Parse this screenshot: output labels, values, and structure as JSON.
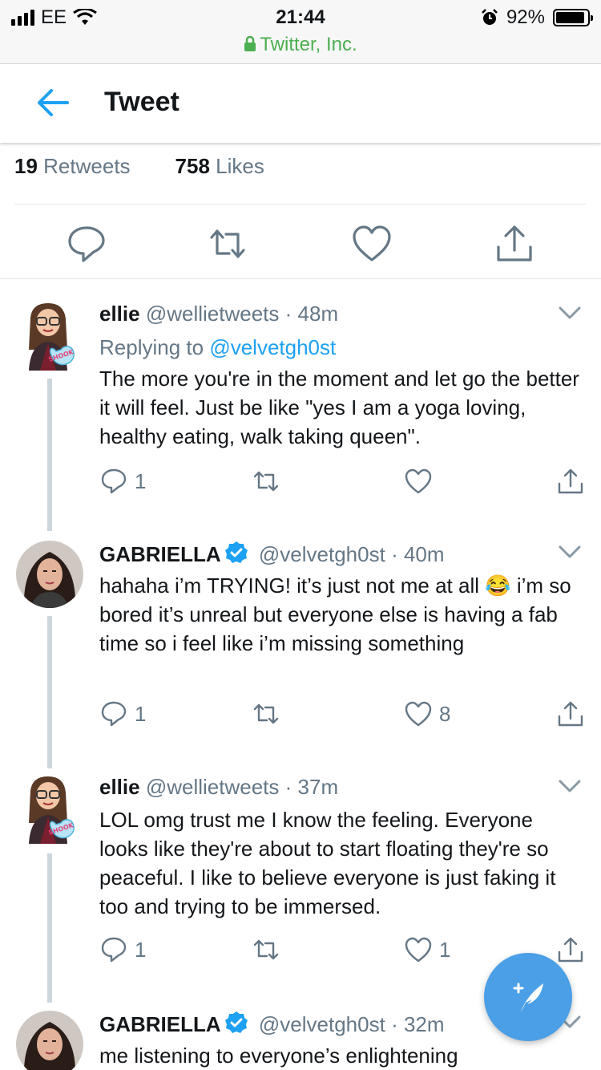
{
  "status_bar": {
    "carrier": "EE",
    "time": "21:44",
    "url": "Twitter, Inc.",
    "battery": "92%",
    "battery_level": 0.92
  },
  "header": {
    "title": "Tweet"
  },
  "stats": {
    "retweets_count": "19",
    "retweets_label": "Retweets",
    "likes_count": "758",
    "likes_label": "Likes"
  },
  "replies": [
    {
      "name": "ellie",
      "handle": "@wellietweets",
      "time": "48m",
      "replying_prefix": "Replying to",
      "replying_handle": "@velvetgh0st",
      "text": "The more you're in the moment and let go the better it will feel. Just be like \"yes I am a yoga loving, healthy eating, walk taking queen\".",
      "reply_count": "1",
      "like_count": ""
    },
    {
      "name": "GABRIELLA",
      "handle": "@velvetgh0st",
      "time": "40m",
      "text": "hahaha i’m TRYING! it’s just not me at all 😂 i’m so bored it’s unreal but everyone else is having a fab time so i feel like i’m missing something",
      "reply_count": "1",
      "like_count": "8"
    },
    {
      "name": "ellie",
      "handle": "@wellietweets",
      "time": "37m",
      "text": "LOL omg trust me I know the feeling. Everyone looks like they're about to start floating they're so peaceful. I like to believe everyone is just faking it too and trying to be immersed.",
      "reply_count": "1",
      "like_count": "1"
    },
    {
      "name": "GABRIELLA",
      "handle": "@velvetgh0st",
      "time": "32m",
      "text": "me listening to everyone’s enlightening"
    }
  ],
  "avatar_badge": "SHOOK",
  "separator": "·",
  "colors": {
    "accent": "#1da1f2",
    "muted": "#657786",
    "fab": "#4a9fe6"
  }
}
